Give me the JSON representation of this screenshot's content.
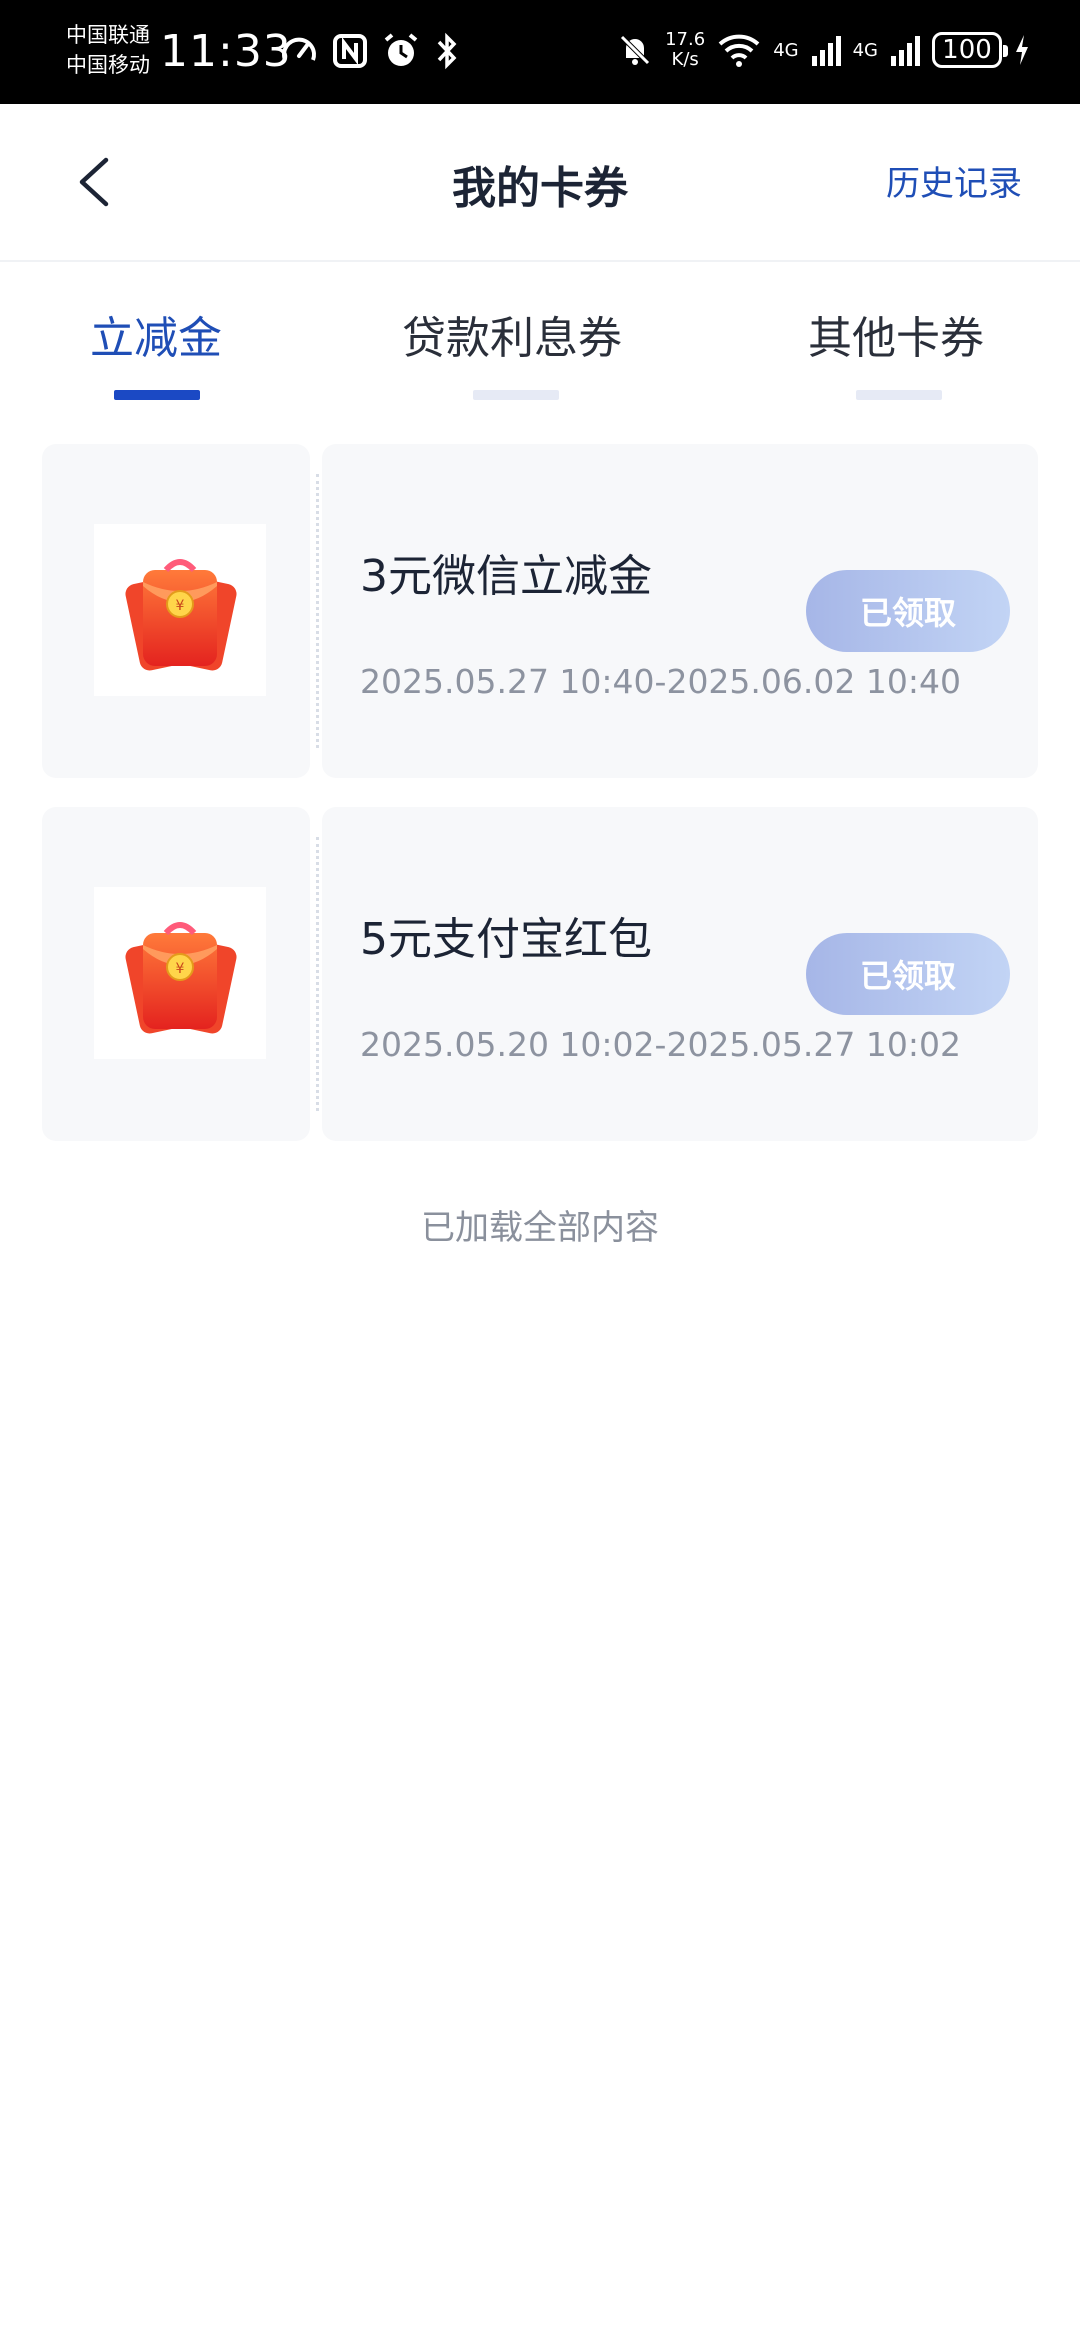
{
  "status_bar": {
    "carrier_1": "中国联通",
    "carrier_2": "中国移动",
    "time": "11:33",
    "net_speed_value": "17.6",
    "net_speed_unit": "K/s",
    "signal_1": "4G",
    "signal_2": "4G",
    "battery": "100"
  },
  "header": {
    "title": "我的卡券",
    "history_label": "历史记录"
  },
  "tabs": [
    {
      "label": "立减金",
      "active": true
    },
    {
      "label": "贷款利息券",
      "active": false
    },
    {
      "label": "其他卡券",
      "active": false
    }
  ],
  "coupons": [
    {
      "name": "3元微信立减金",
      "validity": "2025.05.27 10:40-2025.06.02 10:40",
      "status": "已领取",
      "icon": "red-envelope-icon"
    },
    {
      "name": "5元支付宝红包",
      "validity": "2025.05.20 10:02-2025.05.27 10:02",
      "status": "已领取",
      "icon": "red-envelope-icon"
    }
  ],
  "footer": {
    "loaded_all": "已加载全部内容"
  },
  "colors": {
    "accent": "#1f4eb6",
    "indicator": "#1b49c4",
    "card_bg": "#f7f8fa",
    "button_gradient_start": "#a6b6e7",
    "button_gradient_end": "#c2d4f5"
  }
}
